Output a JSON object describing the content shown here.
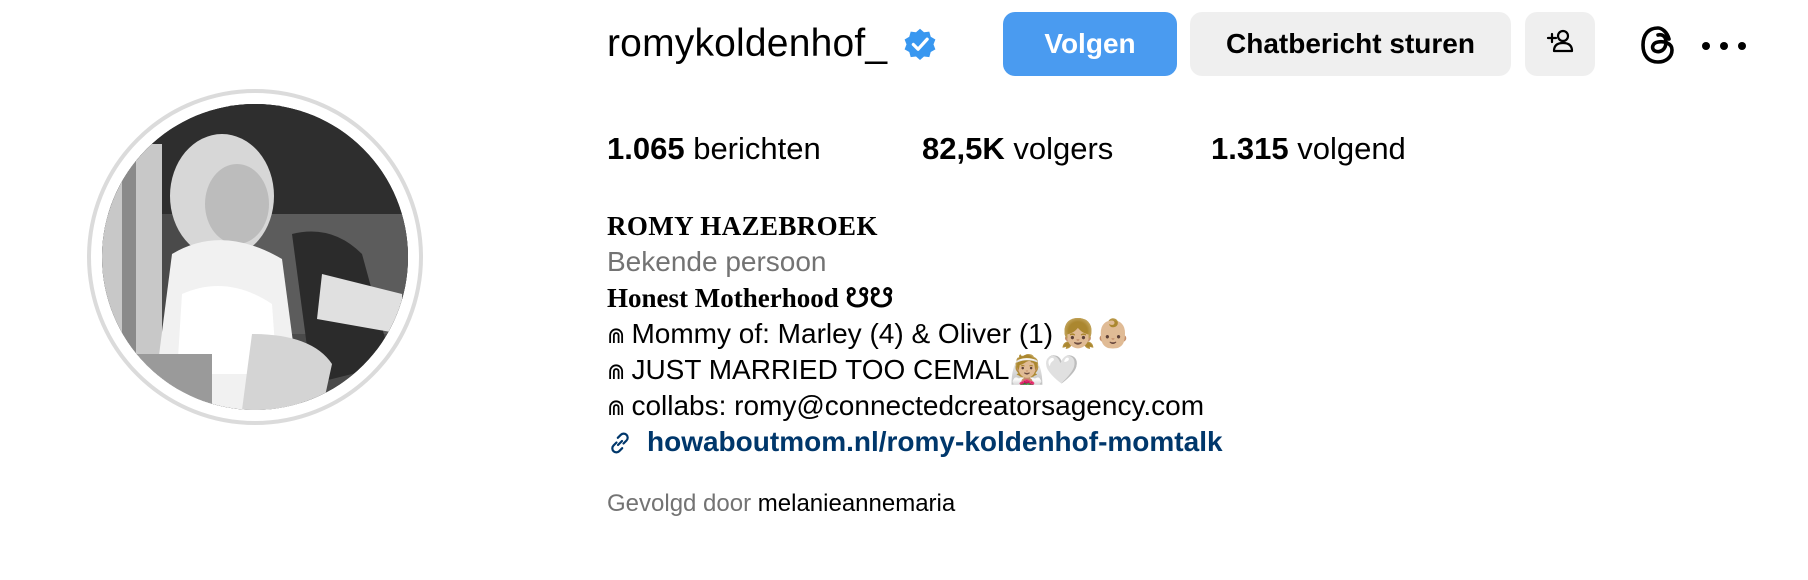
{
  "profile": {
    "username": "romykoldenhof_",
    "verified": true,
    "full_name": "ROMY HAZEBROEK",
    "category": "Bekende persoon",
    "tagline": "Honest Motherhood ☋☋",
    "bio_lines": [
      "Mommy of: Marley (4) & Oliver (1) 👧🏼👶🏼",
      "JUST MARRIED TOO CEMAL👰🏼🤍",
      "collabs: romy@connectedcreatorsagency.com"
    ],
    "bio_bullet": "⋒",
    "link": "howaboutmom.nl/romy-koldenhof-momtalk",
    "followed_by_prefix": "Gevolgd door",
    "followed_by_name": "melanieannemaria"
  },
  "actions": {
    "follow_label": "Volgen",
    "message_label": "Chatbericht sturen"
  },
  "stats": {
    "posts_count": "1.065",
    "posts_label": "berichten",
    "followers_count": "82,5K",
    "followers_label": "volgers",
    "following_count": "1.315",
    "following_label": "volgend"
  },
  "icons": {
    "verified": "verified-badge-icon",
    "suggest": "add-person-icon",
    "threads": "threads-icon",
    "more": "more-options-icon",
    "link": "link-icon"
  },
  "colors": {
    "follow_button": "#4a9bf0",
    "secondary_button": "#efefef",
    "link": "#00376b",
    "muted_text": "#737373",
    "verified_badge": "#3897f0"
  }
}
